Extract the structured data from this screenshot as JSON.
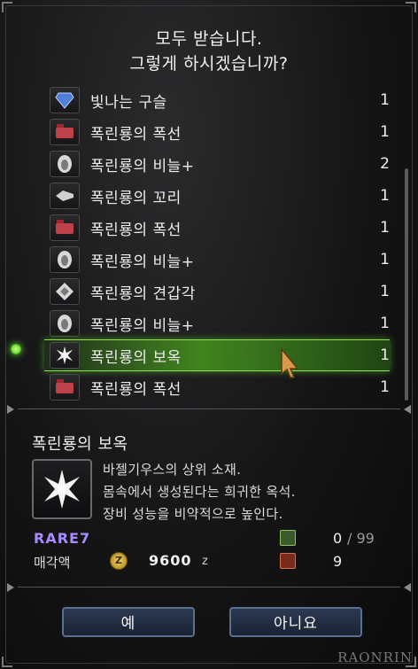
{
  "prompt": {
    "line1": "모두 받습니다.",
    "line2": "그렇게 하시겠습니까?"
  },
  "items": [
    {
      "name": "빛나는 구슬",
      "qty": "1",
      "icon": "gem-icon"
    },
    {
      "name": "폭린룡의 폭선",
      "qty": "1",
      "icon": "gland-icon"
    },
    {
      "name": "폭린룡의 비늘+",
      "qty": "2",
      "icon": "scale-icon"
    },
    {
      "name": "폭린룡의 꼬리",
      "qty": "1",
      "icon": "tail-icon"
    },
    {
      "name": "폭린룡의 폭선",
      "qty": "1",
      "icon": "gland-icon"
    },
    {
      "name": "폭린룡의 비늘+",
      "qty": "1",
      "icon": "scale-icon"
    },
    {
      "name": "폭린룡의 견갑각",
      "qty": "1",
      "icon": "carapace-icon"
    },
    {
      "name": "폭린룡의 비늘+",
      "qty": "1",
      "icon": "scale-icon"
    },
    {
      "name": "폭린룡의 보옥",
      "qty": "1",
      "icon": "gem-star-icon",
      "selected": true
    },
    {
      "name": "폭린룡의 폭선",
      "qty": "1",
      "icon": "gland-icon"
    }
  ],
  "detail": {
    "title": "폭린룡의 보옥",
    "desc_lines": [
      "바젤기우스의 상위 소재.",
      "몸속에서 생성된다는 희귀한 옥석.",
      "장비 성능을 비약적으로 높인다."
    ],
    "rarity": "RARE7",
    "sell_label": "매각액",
    "price": "9600",
    "price_unit": "z",
    "owned": "0",
    "owned_max": "/ 99",
    "box_count": "9"
  },
  "buttons": {
    "yes": "예",
    "no": "아니요"
  },
  "watermark": "RAONRIN",
  "colors": {
    "selected_row": "#4f9a22",
    "rarity": "#a88cff",
    "button_border": "#5b7090"
  }
}
